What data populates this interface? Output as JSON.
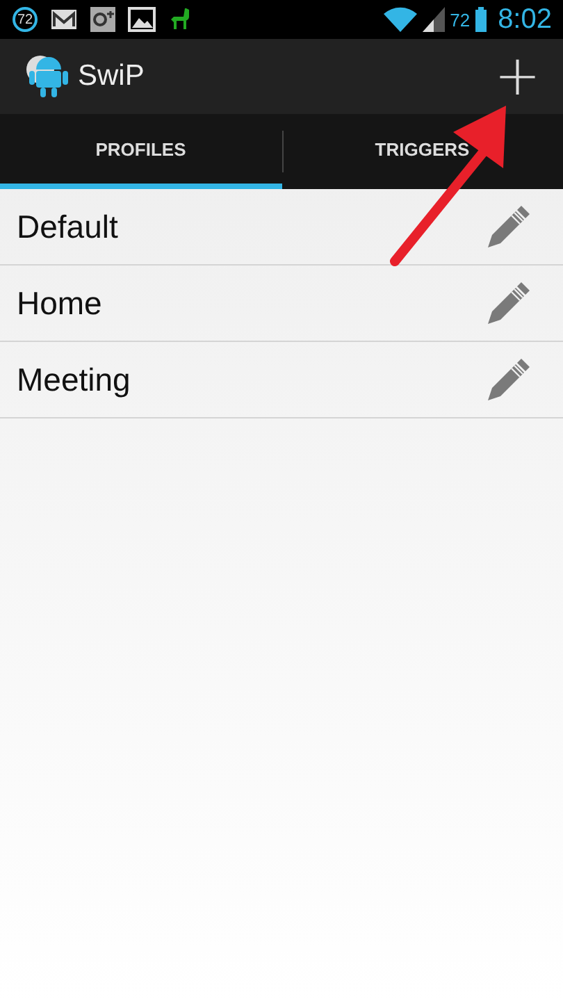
{
  "status_bar": {
    "badge": "72",
    "battery": "72",
    "time": "8:02"
  },
  "action_bar": {
    "title": "SwiP",
    "action": "+"
  },
  "tabs": [
    {
      "label": "PROFILES",
      "selected": true
    },
    {
      "label": "TRIGGERS",
      "selected": false
    }
  ],
  "profiles": [
    {
      "name": "Default"
    },
    {
      "name": "Home"
    },
    {
      "name": "Meeting"
    }
  ]
}
